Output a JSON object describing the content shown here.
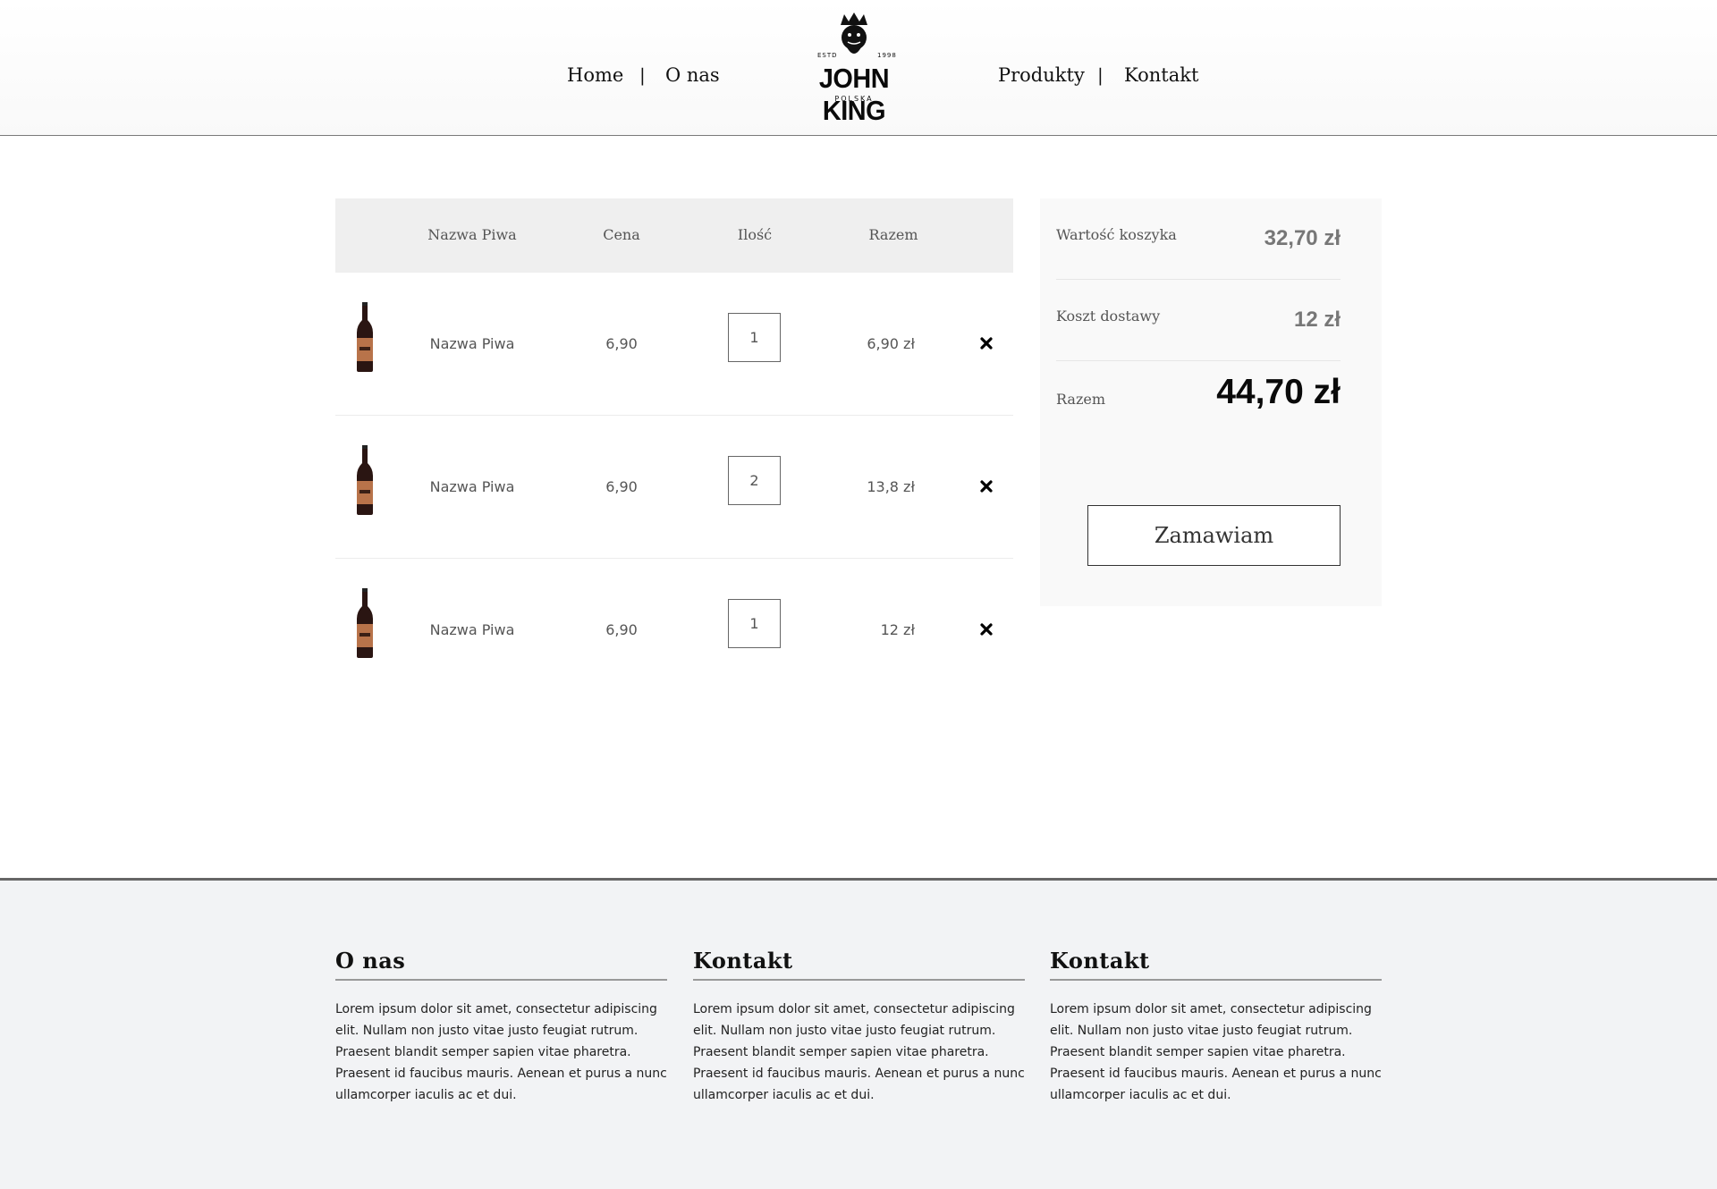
{
  "nav": {
    "home": "Home",
    "about": "O nas",
    "products": "Produkty",
    "contact": "Kontakt",
    "separator": "|"
  },
  "logo": {
    "estd": "ESTD",
    "year": "1998",
    "brand": "JOHN KING",
    "sub": "POLSKA"
  },
  "cart": {
    "headers": {
      "name": "Nazwa Piwa",
      "price": "Cena",
      "qty": "Ilość",
      "total": "Razem"
    },
    "rows": [
      {
        "name": "Nazwa Piwa",
        "price": "6,90",
        "qty": "1",
        "total": "6,90 zł"
      },
      {
        "name": "Nazwa Piwa",
        "price": "6,90",
        "qty": "2",
        "total": "13,8 zł"
      },
      {
        "name": "Nazwa Piwa",
        "price": "6,90",
        "qty": "1",
        "total": "12 zł"
      }
    ]
  },
  "summary": {
    "cart_value_label": "Wartość koszyka",
    "cart_value": "32,70 zł",
    "shipping_label": "Koszt dostawy",
    "shipping": "12 zł",
    "total_label": "Razem",
    "total": "44,70 zł",
    "order_button": "Zamawiam"
  },
  "footer": {
    "columns": [
      {
        "title": "O nas",
        "text": "Lorem ipsum dolor sit amet, consectetur adipiscing elit. Nullam non justo vitae justo feugiat rutrum. Praesent blandit semper sapien vitae pharetra. Praesent id faucibus mauris. Aenean et purus a nunc ullamcorper iaculis ac et dui."
      },
      {
        "title": "Kontakt",
        "text": "Lorem ipsum dolor sit amet, consectetur adipiscing elit. Nullam non justo vitae justo feugiat rutrum. Praesent blandit semper sapien vitae pharetra. Praesent id faucibus mauris. Aenean et purus a nunc ullamcorper iaculis ac et dui."
      },
      {
        "title": "Kontakt",
        "text": "Lorem ipsum dolor sit amet, consectetur adipiscing elit. Nullam non justo vitae justo feugiat rutrum. Praesent blandit semper sapien vitae pharetra. Praesent id faucibus mauris. Aenean et purus a nunc ullamcorper iaculis ac et dui."
      }
    ]
  },
  "icons": {
    "remove": "close-icon",
    "product": "beer-bottle-icon"
  },
  "colors": {
    "accent": "#0a0a0a",
    "header_border": "#7a7a7a",
    "table_head_bg": "#efefef",
    "footer_bg": "#f2f3f5",
    "bottle_label": "#b8734a"
  }
}
